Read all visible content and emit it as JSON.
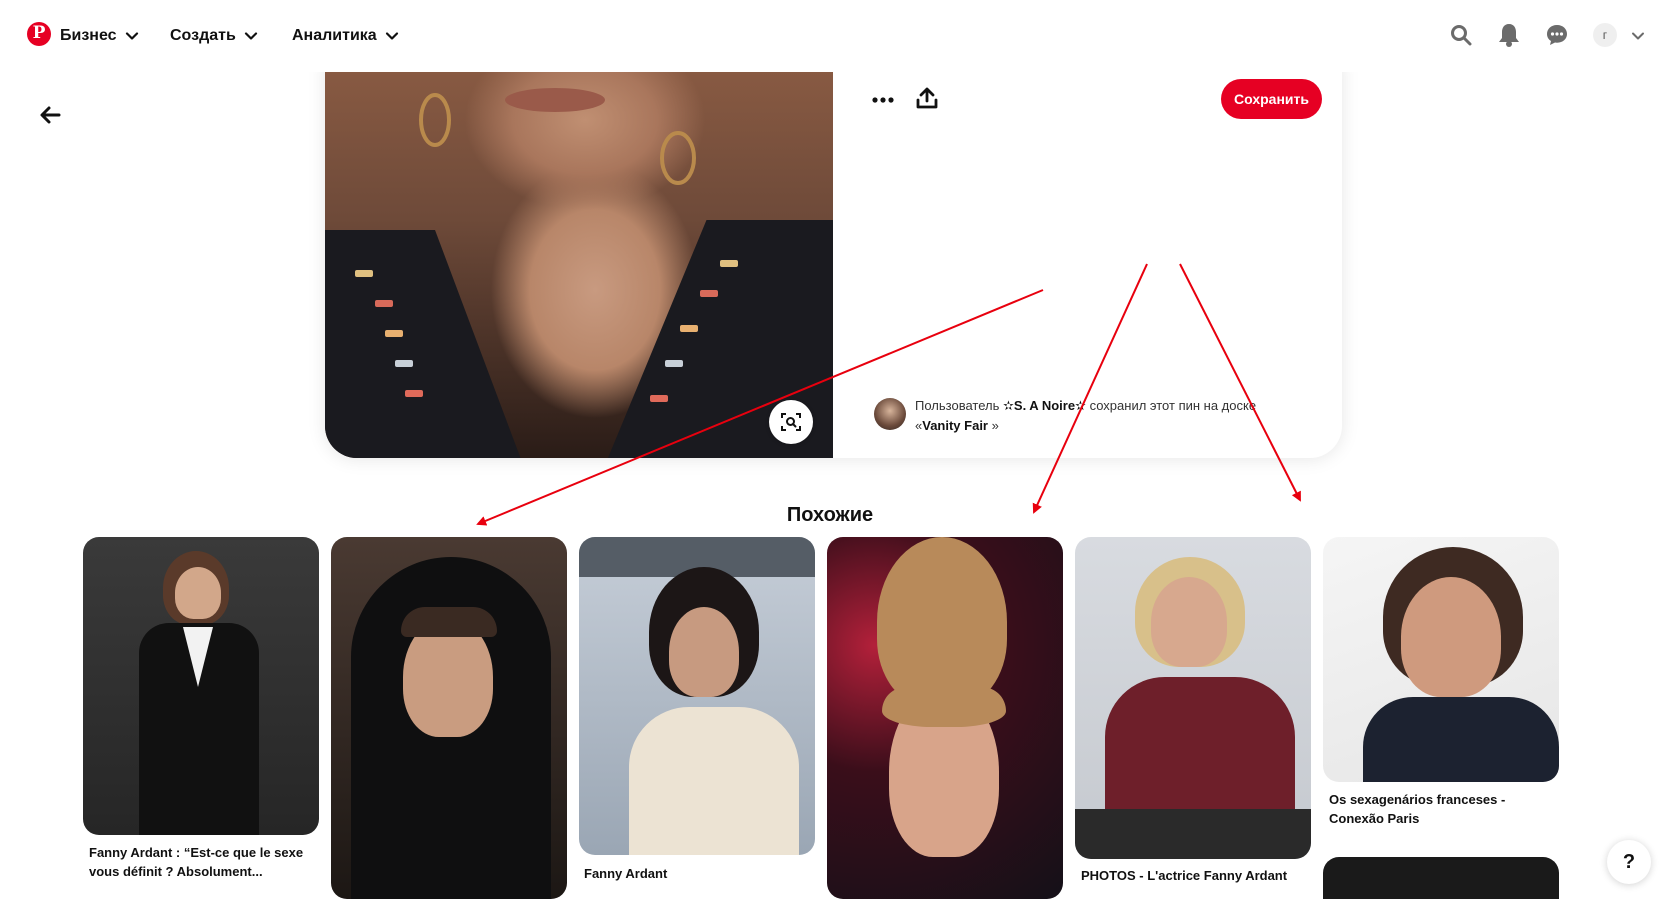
{
  "nav": {
    "items": [
      {
        "label": "Бизнес"
      },
      {
        "label": "Создать"
      },
      {
        "label": "Аналитика"
      }
    ],
    "avatar_initial": "г"
  },
  "closeup": {
    "save_label": "Сохранить",
    "saver_prefix": "Пользователь",
    "saver_name": "✫S. A Noire✫",
    "saver_middle": "сохранил этот пин на доске",
    "board_open": "«",
    "board_name": "Vanity Fair",
    "board_close": "»"
  },
  "similar": {
    "title": "Похожие",
    "pins": [
      {
        "caption": "Fanny Ardant : “Est-ce que le sexe vous définit ? Absolument..."
      },
      {
        "caption": ""
      },
      {
        "caption": "Fanny Ardant"
      },
      {
        "caption": ""
      },
      {
        "caption": "PHOTOS - L'actrice Fanny Ardant"
      },
      {
        "caption": "Os sexagenários franceses - Conexão Paris"
      }
    ]
  },
  "help_label": "?",
  "colors": {
    "brand": "#e60023",
    "annotation": "#e8000e"
  },
  "icons": [
    "pinterest-logo-icon",
    "chevron-down-icon",
    "search-icon",
    "bell-icon",
    "chat-icon",
    "arrow-left-icon",
    "more-icon",
    "share-icon",
    "visual-search-icon",
    "help-icon"
  ]
}
